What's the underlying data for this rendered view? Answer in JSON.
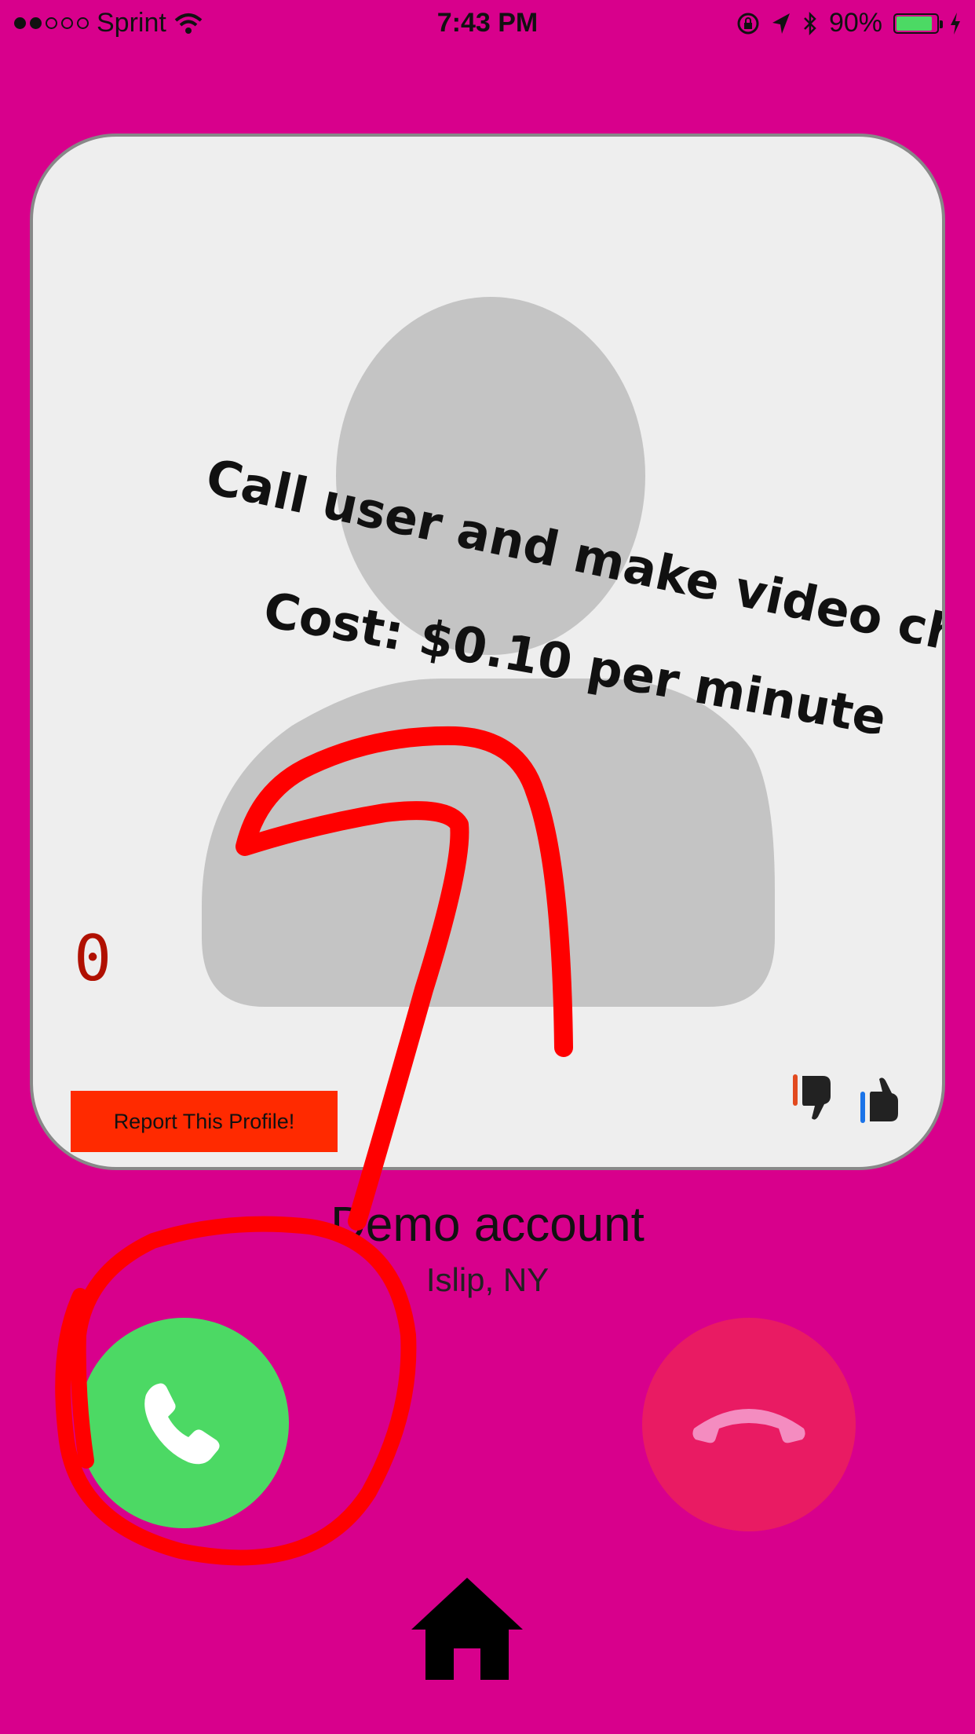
{
  "status_bar": {
    "carrier": "Sprint",
    "time": "7:43 PM",
    "battery_percent": "90%",
    "battery_level": 0.9,
    "signal_bars_filled": 2,
    "signal_bars_total": 5
  },
  "card": {
    "promo_line1": "Call user and make video chat!",
    "promo_line2": "Cost: $0.10 per minute",
    "counter": "0",
    "report_button_label": "Report This Profile!"
  },
  "profile": {
    "name": "Demo account",
    "location": "Islip, NY"
  },
  "colors": {
    "background": "#d8008c",
    "call": "#4cd964",
    "hangup": "#e91b63",
    "report": "#ff2a00",
    "annotation": "#ff0000"
  },
  "icons": [
    "wifi-icon",
    "rotation-lock-icon",
    "location-arrow-icon",
    "bluetooth-icon",
    "battery-icon",
    "charging-icon",
    "thumbs-down-icon",
    "thumbs-up-icon",
    "phone-icon",
    "hangup-icon",
    "home-icon"
  ]
}
